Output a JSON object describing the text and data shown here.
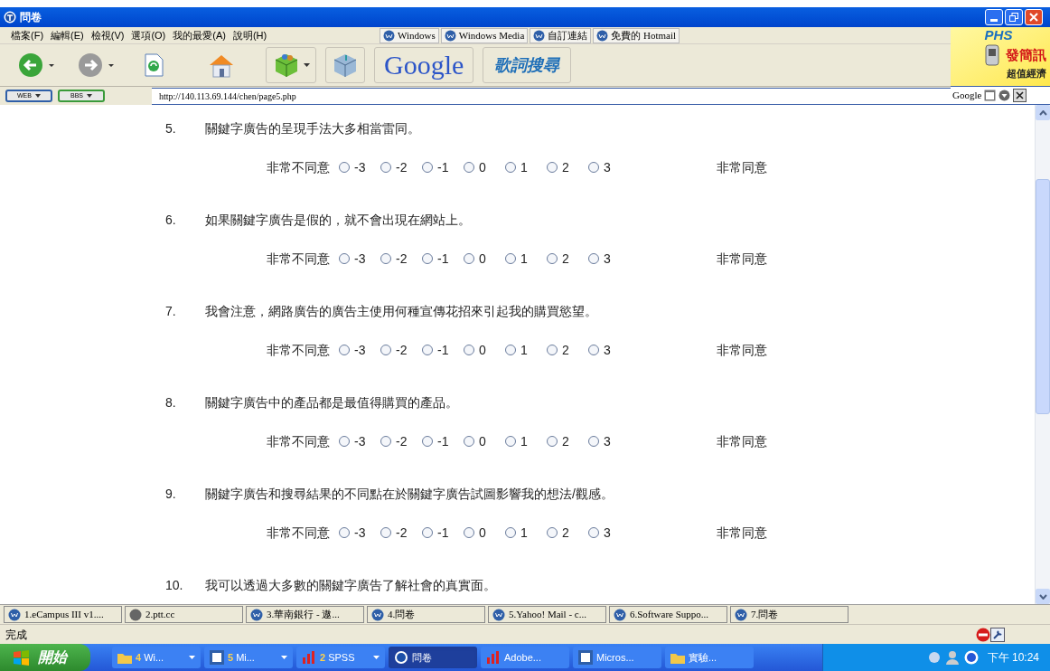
{
  "window": {
    "title": "問卷"
  },
  "menu": [
    "檔案(F)",
    "編輯(E)",
    "檢視(V)",
    "選項(O)",
    "我的最愛(A)",
    "說明(H)"
  ],
  "links": [
    "Windows",
    "Windows Media",
    "自訂連結",
    "免費的 Hotmail"
  ],
  "toolbar": {
    "search_logo": "Google",
    "lyrics_button": "歌詞搜尋"
  },
  "ad": {
    "brand": "PHS",
    "headline": "發簡訊",
    "tagline": "超值經濟"
  },
  "address": {
    "buttons": [
      "WEB",
      "BBS"
    ],
    "url": "http://140.113.69.144/chen/page5.php",
    "search_label": "Google"
  },
  "questions": [
    {
      "number": "5.",
      "text": "關鍵字廣告的呈現手法大多相當雷同。",
      "left": "非常不同意",
      "right": "非常同意",
      "options": [
        {
          "label": "-3",
          "selected": false
        },
        {
          "label": "-2",
          "selected": false
        },
        {
          "label": "-1",
          "selected": false
        },
        {
          "label": "0",
          "selected": false
        },
        {
          "label": "1",
          "selected": false
        },
        {
          "label": "2",
          "selected": false
        },
        {
          "label": "3",
          "selected": false
        }
      ]
    },
    {
      "number": "6.",
      "text": "如果關鍵字廣告是假的，就不會出現在網站上。",
      "left": "非常不同意",
      "right": "非常同意",
      "options": [
        {
          "label": "-3",
          "selected": false
        },
        {
          "label": "-2",
          "selected": false
        },
        {
          "label": "-1",
          "selected": false
        },
        {
          "label": "0",
          "selected": false
        },
        {
          "label": "1",
          "selected": false
        },
        {
          "label": "2",
          "selected": false
        },
        {
          "label": "3",
          "selected": false
        }
      ]
    },
    {
      "number": "7.",
      "text": "我會注意，網路廣告的廣告主使用何種宣傳花招來引起我的購買慾望。",
      "left": "非常不同意",
      "right": "非常同意",
      "options": [
        {
          "label": "-3",
          "selected": false
        },
        {
          "label": "-2",
          "selected": false
        },
        {
          "label": "-1",
          "selected": false
        },
        {
          "label": "0",
          "selected": false
        },
        {
          "label": "1",
          "selected": false
        },
        {
          "label": "2",
          "selected": false
        },
        {
          "label": "3",
          "selected": false
        }
      ]
    },
    {
      "number": "8.",
      "text": "關鍵字廣告中的產品都是最值得購買的產品。",
      "left": "非常不同意",
      "right": "非常同意",
      "options": [
        {
          "label": "-3",
          "selected": false
        },
        {
          "label": "-2",
          "selected": false
        },
        {
          "label": "-1",
          "selected": false
        },
        {
          "label": "0",
          "selected": false
        },
        {
          "label": "1",
          "selected": false
        },
        {
          "label": "2",
          "selected": false
        },
        {
          "label": "3",
          "selected": false
        }
      ]
    },
    {
      "number": "9.",
      "text": "關鍵字廣告和搜尋結果的不同點在於關鍵字廣告試圖影響我的想法/觀感。",
      "left": "非常不同意",
      "right": "非常同意",
      "options": [
        {
          "label": "-3",
          "selected": false
        },
        {
          "label": "-2",
          "selected": false
        },
        {
          "label": "-1",
          "selected": false
        },
        {
          "label": "0",
          "selected": false
        },
        {
          "label": "1",
          "selected": false
        },
        {
          "label": "2",
          "selected": false
        },
        {
          "label": "3",
          "selected": false
        }
      ]
    },
    {
      "number": "10.",
      "text": "我可以透過大多數的關鍵字廣告了解社會的真實面。"
    }
  ],
  "tabs": [
    "1.eCampus III v1....",
    "2.ptt.cc",
    "3.華南銀行 - 遨...",
    "4.問卷",
    "5.Yahoo! Mail - c...",
    "6.Software Suppo...",
    "7.問卷"
  ],
  "status_bar": {
    "text": "完成"
  },
  "taskbar": {
    "start": "開始",
    "items": [
      {
        "count": "4",
        "label": "Wi...",
        "kind": "group",
        "selected": false
      },
      {
        "count": "5",
        "label": "Mi...",
        "kind": "group",
        "selected": false
      },
      {
        "count": "2",
        "label": "SPSS",
        "kind": "group",
        "selected": false
      },
      {
        "label": "問卷",
        "kind": "window",
        "selected": true
      },
      {
        "label": "Adobe...",
        "kind": "window",
        "selected": false
      },
      {
        "label": "Micros...",
        "kind": "window",
        "selected": false
      },
      {
        "label": "實驗...",
        "kind": "window",
        "selected": false
      }
    ],
    "clock": "下午 10:24"
  }
}
